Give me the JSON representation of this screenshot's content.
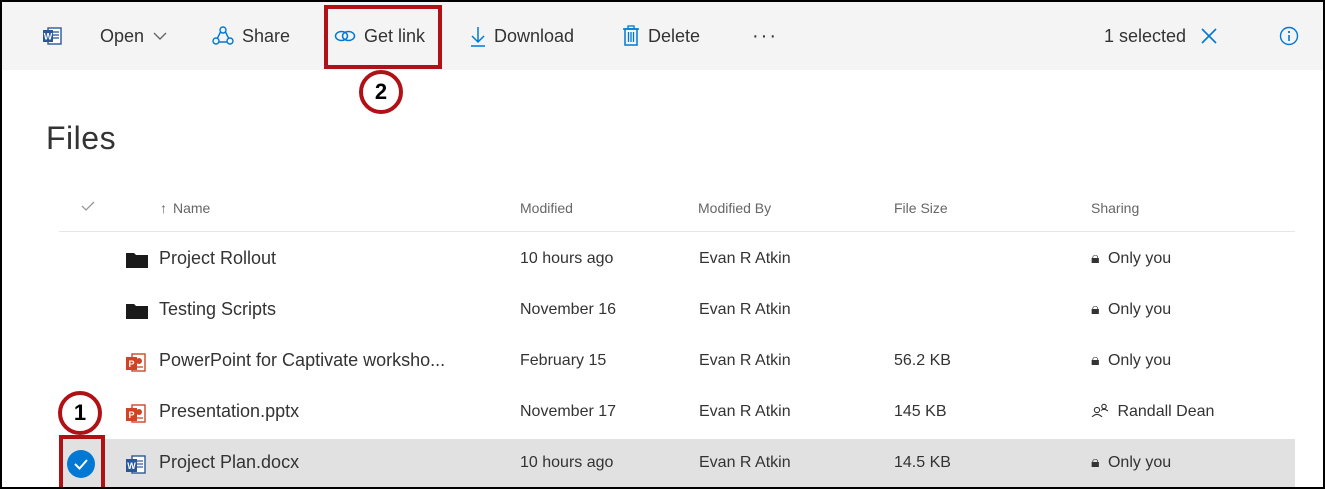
{
  "toolbar": {
    "open_label": "Open",
    "share_label": "Share",
    "get_link_label": "Get link",
    "download_label": "Download",
    "delete_label": "Delete",
    "more_label": "···",
    "selected_label": "1 selected"
  },
  "page": {
    "title": "Files"
  },
  "columns": {
    "name": "Name",
    "modified": "Modified",
    "modified_by": "Modified By",
    "file_size": "File Size",
    "sharing": "Sharing"
  },
  "rows": [
    {
      "icon": "folder-icon",
      "name": "Project Rollout",
      "modified": "10 hours ago",
      "modified_by": "Evan R Atkin",
      "size": "",
      "sharing": "Only you",
      "sharing_icon": "lock-icon",
      "selected": false
    },
    {
      "icon": "folder-icon",
      "name": "Testing Scripts",
      "modified": "November 16",
      "modified_by": "Evan R Atkin",
      "size": "",
      "sharing": "Only you",
      "sharing_icon": "lock-icon",
      "selected": false
    },
    {
      "icon": "powerpoint-icon",
      "name": "PowerPoint for Captivate worksho...",
      "modified": "February 15",
      "modified_by": "Evan R Atkin",
      "size": "56.2 KB",
      "sharing": "Only you",
      "sharing_icon": "lock-icon",
      "selected": false
    },
    {
      "icon": "powerpoint-icon",
      "name": "Presentation.pptx",
      "modified": "November 17",
      "modified_by": "Evan R Atkin",
      "size": "145 KB",
      "sharing": "Randall Dean",
      "sharing_icon": "people-icon",
      "selected": false
    },
    {
      "icon": "word-icon",
      "name": "Project Plan.docx",
      "modified": "10 hours ago",
      "modified_by": "Evan R Atkin",
      "size": "14.5 KB",
      "sharing": "Only you",
      "sharing_icon": "lock-icon",
      "selected": true
    }
  ],
  "callouts": {
    "one": "1",
    "two": "2"
  },
  "colors": {
    "accent": "#0078d4",
    "callout": "#b01116",
    "toolbar_bg": "#f4f4f4",
    "selected_row": "#e1e1e1"
  }
}
